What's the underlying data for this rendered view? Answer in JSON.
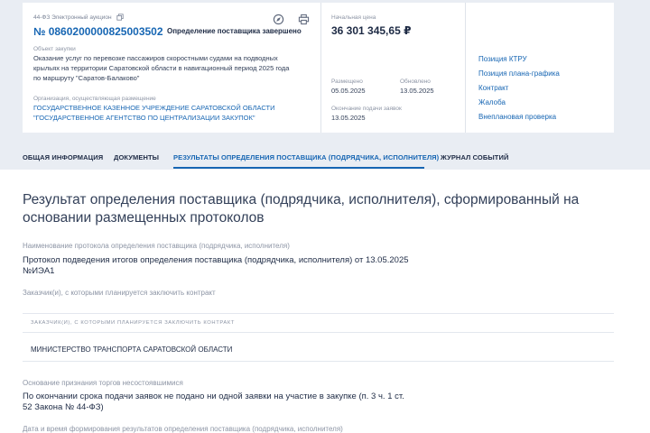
{
  "card": {
    "registry": "44-ФЗ Электронный аукцион",
    "number": "№ 0860200000825003502",
    "status": "Определение поставщика завершено",
    "object_label": "Объект закупки",
    "object_lines": [
      "Оказание услуг по перевозке пассажиров скоростными судами на подводных",
      "крыльях на территории Саратовской области в навигационный период 2025 года",
      "по маршруту \"Саратов-Балаково\""
    ],
    "org_label": "Организация, осуществляющая размещение",
    "org_lines": [
      "ГОСУДАРСТВЕННОЕ КАЗЕННОЕ УЧРЕЖДЕНИЕ САРАТОВСКОЙ ОБЛАСТИ",
      "\"ГОСУДАРСТВЕННОЕ АГЕНТСТВО ПО ЦЕНТРАЛИЗАЦИИ ЗАКУПОК\""
    ],
    "price_label": "Начальная цена",
    "price": "36 301 345,65 ₽",
    "placed_label": "Размещено",
    "placed": "05.05.2025",
    "updated_label": "Обновлено",
    "updated": "13.05.2025",
    "deadline_label": "Окончание подачи заявок",
    "deadline": "13.05.2025",
    "links": [
      "Позиция КТРУ",
      "Позиция плана-графика",
      "Контракт",
      "Жалоба",
      "Внеплановая проверка"
    ],
    "icons": {
      "copy": "copy-icon",
      "compass": "compass-icon",
      "print": "print-icon"
    }
  },
  "tabs": [
    "ОБЩАЯ ИНФОРМАЦИЯ",
    "ДОКУМЕНТЫ",
    "РЕЗУЛЬТАТЫ ОПРЕДЕЛЕНИЯ ПОСТАВЩИКА (ПОДРЯДЧИКА, ИСПОЛНИТЕЛЯ)",
    "ЖУРНАЛ СОБЫТИЙ"
  ],
  "main": {
    "title_lines": [
      "Результат определения поставщика (подрядчика, исполнителя), сформированный на",
      "основании размещенных протоколов"
    ],
    "protocol_label": "Наименование протокола определения поставщика (подрядчика, исполнителя)",
    "protocol_lines": [
      "Протокол подведения итогов определения поставщика (подрядчика, исполнителя) от 13.05.2025",
      "№ИЭА1"
    ],
    "customers_label": "Заказчик(и), с которыми планируется заключить контракт",
    "table_header": "ЗАКАЗЧИК(И), С КОТОРЫМИ ПЛАНИРУЕТСЯ ЗАКЛЮЧИТЬ КОНТРАКТ",
    "table_row": "МИНИСТЕРСТВО ТРАНСПОРТА САРАТОВСКОЙ ОБЛАСТИ",
    "reason_label": "Основание признания торгов несостоявшимися",
    "reason_lines": [
      "По окончании срока подачи заявок не подано ни одной заявки на участие в закупке (п. 3 ч. 1 ст.",
      "52 Закона № 44-ФЗ)"
    ],
    "datetime_label": "Дата и время формирования результатов определения поставщика (подрядчика, исполнителя)"
  },
  "colors": {
    "accent": "#1766b3",
    "background": "#e9edf3"
  }
}
